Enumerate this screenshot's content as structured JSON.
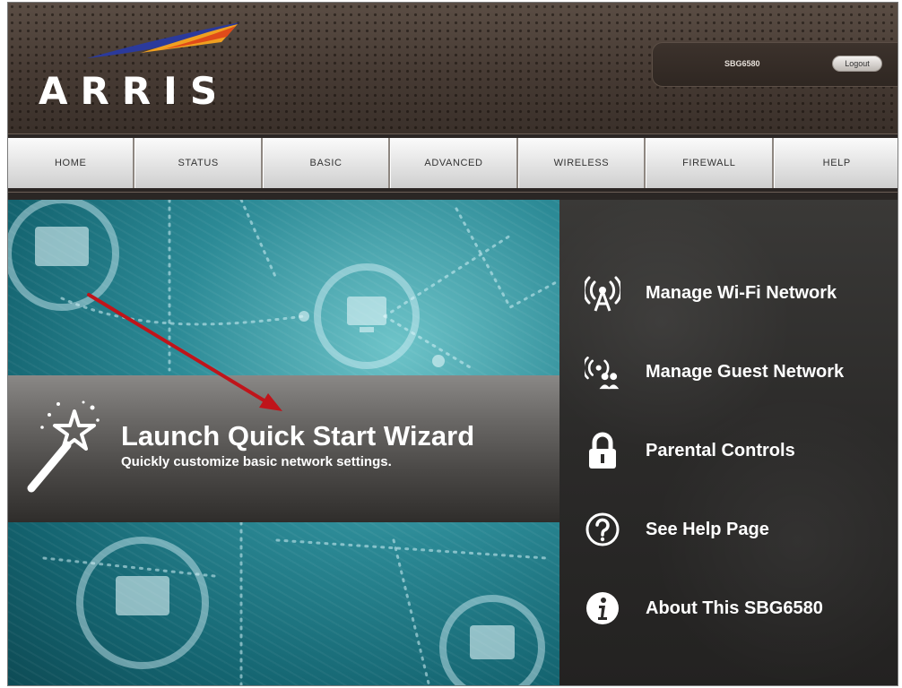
{
  "header": {
    "logo_text": "ARRIS",
    "username": "SBG6580",
    "logout_label": "Logout"
  },
  "nav": {
    "items": [
      {
        "label": "HOME"
      },
      {
        "label": "STATUS"
      },
      {
        "label": "BASIC"
      },
      {
        "label": "ADVANCED"
      },
      {
        "label": "WIRELESS"
      },
      {
        "label": "FIREWALL"
      },
      {
        "label": "HELP"
      }
    ]
  },
  "wizard": {
    "title": "Launch Quick Start Wizard",
    "subtitle": "Quickly customize basic network settings."
  },
  "quick_links": [
    {
      "label": "Manage Wi-Fi Network",
      "icon": "wifi-tower-icon"
    },
    {
      "label": "Manage Guest Network",
      "icon": "guest-network-icon"
    },
    {
      "label": "Parental Controls",
      "icon": "lock-icon"
    },
    {
      "label": "See Help Page",
      "icon": "help-icon"
    },
    {
      "label": "About This SBG6580",
      "icon": "info-icon"
    }
  ],
  "colors": {
    "header_brown": "#4a3f38",
    "teal": "#2c8a96",
    "annotation_red": "#c0141a",
    "logo_blue": "#2b3a9c",
    "logo_orange": "#f0a020"
  }
}
